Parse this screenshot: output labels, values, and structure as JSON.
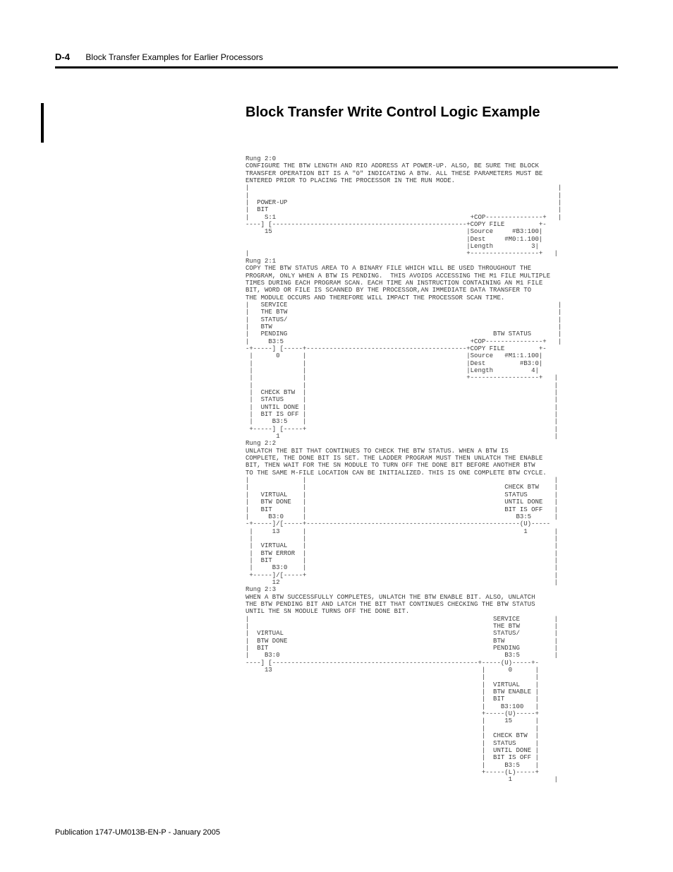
{
  "header": {
    "page_number": "D-4",
    "chapter_title": "Block Transfer Examples for Earlier Processors"
  },
  "section_title": "Block Transfer Write Control Logic Example",
  "ladder_text": "Rung 2:0\nCONFIGURE THE BTW LENGTH AND RIO ADDRESS AT POWER-UP. ALSO, BE SURE THE BLOCK\nTRANSFER OPERATION BIT IS A \"0\" INDICATING A BTW. ALL THESE PARAMETERS MUST BE\nENTERED PRIOR TO PLACING THE PROCESSOR IN THE RUN MODE.\n|                                                                                 |\n|                                                                                 |\n|  POWER-UP                                                                       |\n|  BIT                                                                            |\n|    S:1                                                   +COP---------------+   |\n----] [---------------------------------------------------+COPY FILE         +-\n     15                                                   |Source     #B3:100|\n                                                          |Dest     #M0:1.100|\n                                                          |Length          3|\n|                                                         +------------------+   |\nRung 2:1\nCOPY THE BTW STATUS AREA TO A BINARY FILE WHICH WILL BE USED THROUGHOUT THE\nPROGRAM, ONLY WHEN A BTW IS PENDING.  THIS AVOIDS ACCESSING THE M1 FILE MULTIPLE\nTIMES DURING EACH PROGRAM SCAN. EACH TIME AN INSTRUCTION CONTAINING AN M1 FILE\nBIT, WORD OR FILE IS SCANNED BY THE PROCESSOR,AN IMMEDIATE DATA TRANSFER TO\nTHE MODULE OCCURS AND THEREFORE WILL IMPACT THE PROCESSOR SCAN TIME.\n|   SERVICE                                                                       |\n|   THE BTW                                                                       |\n|   STATUS/                                                                       |\n|   BTW                                                                           |\n|   PENDING                                                      BTW STATUS       |\n|     B3:5                                                 +COP---------------+   |\n-+-----] [-----+------------------------------------------+COPY FILE         +-\n |      0      |                                          |Source   #M1:1.100|\n |             |                                          |Dest         #B3:0|\n |             |                                          |Length          4|\n |             |                                          +------------------+   |\n |             |                                                                 |\n |  CHECK BTW  |                                                                 |\n |  STATUS     |                                                                 |\n |  UNTIL DONE |                                                                 |\n |  BIT IS OFF |                                                                 |\n |     B3:5    |                                                                 |\n +-----] [-----+                                                                 |\n        1                                                                        |\nRung 2:2\nUNLATCH THE BIT THAT CONTINUES TO CHECK THE BTW STATUS. WHEN A BTW IS\nCOMPLETE, THE DONE BIT IS SET. THE LADDER PROGRAM MUST THEN UNLATCH THE ENABLE\nBIT, THEN WAIT FOR THE SN MODULE TO TURN OFF THE DONE BIT BEFORE ANOTHER BTW\nTO THE SAME M-FILE LOCATION CAN BE INITIALIZED. THIS IS ONE COMPLETE BTW CYCLE.\n|              |                                                                 |\n|              |                                                    CHECK BTW    |\n|   VIRTUAL    |                                                    STATUS       |\n|   BTW DONE   |                                                    UNTIL DONE   |\n|   BIT        |                                                    BIT IS OFF   |\n|     B3:0     |                                                       B3:5      |\n-+-----]/[-----+--------------------------------------------------------(U)-----\n |     13      |                                                         1       |\n |             |                                                                 |\n |  VIRTUAL    |                                                                 |\n |  BTW ERROR  |                                                                 |\n |  BIT        |                                                                 |\n |     B3:0    |                                                                 |\n +-----]/[-----+                                                                 |\n       12                                                                        |\nRung 2:3\nWHEN A BTW SUCCESSFULLY COMPLETES, UNLATCH THE BTW ENABLE BIT. ALSO, UNLATCH\nTHE BTW PENDING BIT AND LATCH THE BIT THAT CONTINUES CHECKING THE BTW STATUS\nUNTIL THE SN MODULE TURNS OFF THE DONE BIT.\n|                                                                SERVICE         |\n|                                                                THE BTW         |\n|  VIRTUAL                                                       STATUS/         |\n|  BTW DONE                                                      BTW             |\n|  BIT                                                           PENDING         |\n|    B3:0                                                           B3:5         |\n----] [------------------------------------------------------+-----(U)-----+-\n     13                                                       |      0      |\n                                                              |             |\n                                                              |  VIRTUAL    |\n                                                              |  BTW ENABLE |\n                                                              |  BIT        |\n                                                              |    B3:100   |\n                                                              +-----(U)-----+\n                                                              |     15      |\n                                                              |             |\n                                                              |  CHECK BTW  |\n                                                              |  STATUS     |\n                                                              |  UNTIL DONE |\n                                                              |  BIT IS OFF |\n                                                              |     B3:5    |\n                                                              +-----(L)-----+\n                                                                     1           |",
  "footer": {
    "publication": "Publication 1747-UM013B-EN-P - January 2005"
  }
}
